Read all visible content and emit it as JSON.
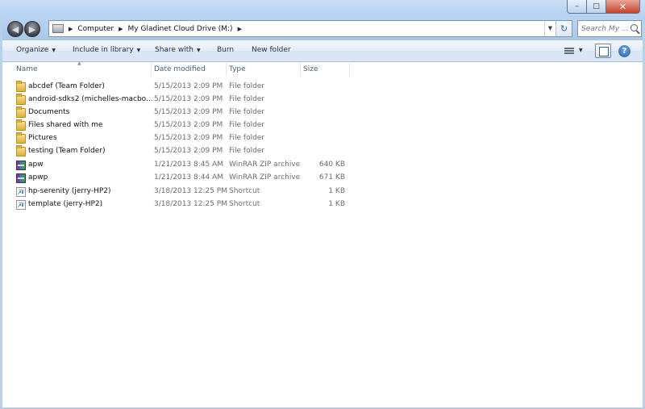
{
  "window": {
    "controls": {
      "minimize": "–",
      "maximize": "□",
      "close": "✕"
    }
  },
  "navigation": {
    "back_icon": "back-arrow-icon",
    "forward_icon": "forward-arrow-icon",
    "breadcrumb": [
      "Computer",
      "My Gladinet Cloud Drive (M:)"
    ],
    "search_placeholder": "Search My ..."
  },
  "toolbar": {
    "organize": "Organize",
    "include_in_library": "Include in library",
    "share_with": "Share with",
    "burn": "Burn",
    "new_folder": "New folder"
  },
  "columns": {
    "name": "Name",
    "date_modified": "Date modified",
    "type": "Type",
    "size": "Size"
  },
  "files": [
    {
      "name": "abcdef (Team Folder)",
      "date": "5/15/2013 2:09 PM",
      "type": "File folder",
      "size": "",
      "icon": "folder"
    },
    {
      "name": "android-sdks2 (michelles-macbo...",
      "date": "5/15/2013 2:09 PM",
      "type": "File folder",
      "size": "",
      "icon": "folder"
    },
    {
      "name": "Documents",
      "date": "5/15/2013 2:09 PM",
      "type": "File folder",
      "size": "",
      "icon": "folder"
    },
    {
      "name": "Files shared with me",
      "date": "5/15/2013 2:09 PM",
      "type": "File folder",
      "size": "",
      "icon": "folder"
    },
    {
      "name": "Pictures",
      "date": "5/15/2013 2:09 PM",
      "type": "File folder",
      "size": "",
      "icon": "folder"
    },
    {
      "name": "testing (Team Folder)",
      "date": "5/15/2013 2:09 PM",
      "type": "File folder",
      "size": "",
      "icon": "folder"
    },
    {
      "name": "apw",
      "date": "1/21/2013 8:45 AM",
      "type": "WinRAR ZIP archive",
      "size": "640 KB",
      "icon": "zip"
    },
    {
      "name": "apwp",
      "date": "1/21/2013 8:44 AM",
      "type": "WinRAR ZIP archive",
      "size": "671 KB",
      "icon": "zip"
    },
    {
      "name": "hp-serenity (jerry-HP2)",
      "date": "3/18/2013 12:25 PM",
      "type": "Shortcut",
      "size": "1 KB",
      "icon": "shortcut"
    },
    {
      "name": "template (jerry-HP2)",
      "date": "3/18/2013 12:25 PM",
      "type": "Shortcut",
      "size": "1 KB",
      "icon": "shortcut"
    }
  ]
}
